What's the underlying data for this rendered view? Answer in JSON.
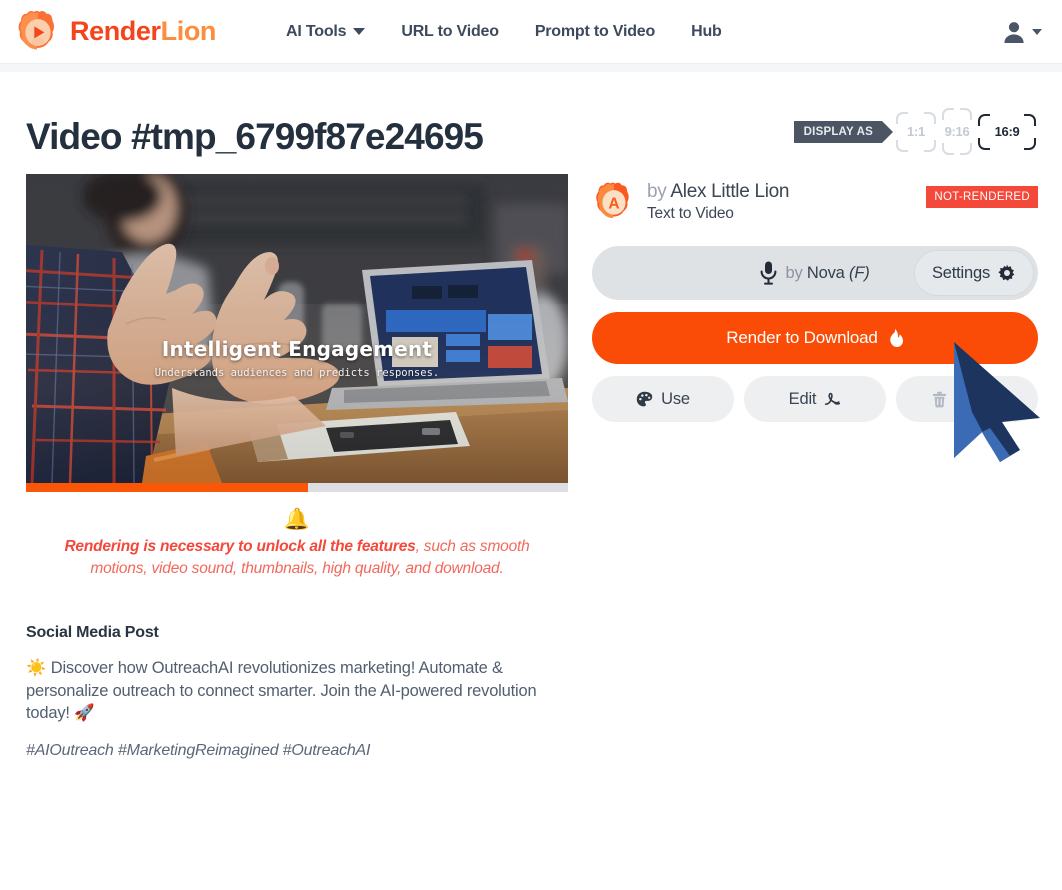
{
  "header": {
    "brand": {
      "part1": "Render",
      "part2": "Lion",
      "logo_icon": "lion-play-logo"
    },
    "nav": [
      {
        "label": "AI Tools",
        "has_caret": true
      },
      {
        "label": "URL to Video",
        "has_caret": false
      },
      {
        "label": "Prompt to Video",
        "has_caret": false
      },
      {
        "label": "Hub",
        "has_caret": false
      }
    ],
    "account": {
      "icon": "user-avatar-icon",
      "caret": "chevron-down-icon"
    }
  },
  "page": {
    "title": "Video #tmp_6799f87e24695"
  },
  "display_as": {
    "label": "DISPLAY AS",
    "options": [
      {
        "label": "1:1",
        "active": false
      },
      {
        "label": "9:16",
        "active": false
      },
      {
        "label": "16:9",
        "active": true
      }
    ]
  },
  "video": {
    "overlay_title": "Intelligent Engagement",
    "overlay_subtitle": "Understands audiences and predicts responses.",
    "progress_percent": 52
  },
  "warning": {
    "icon": "bell-icon",
    "bold_part": "Rendering is necessary to unlock all the features",
    "rest_part": ", such as smooth motions, video sound, thumbnails, high quality, and download."
  },
  "post": {
    "heading": "Social Media Post",
    "body": "☀️  Discover how OutreachAI revolutionizes marketing! Automate & personalize outreach to connect smarter. Join the AI-powered revolution today! 🚀",
    "tags": "#AIOutreach #MarketingReimagined #OutreachAI"
  },
  "author": {
    "avatar_icon": "lion-avatar-a",
    "by_word": "by",
    "name": "Alex Little Lion",
    "type": "Text to Video",
    "status": "NOT-RENDERED"
  },
  "voice": {
    "mic_icon": "microphone-icon",
    "by_word": "by",
    "name": "Nova",
    "gender": "(F)",
    "settings_label": "Settings",
    "settings_icon": "gear-icon"
  },
  "render": {
    "label": "Render to Download",
    "icon": "fire-icon"
  },
  "actions": [
    {
      "label": "Use",
      "icon": "palette-icon",
      "icon_side": "left",
      "muted": false
    },
    {
      "label": "Edit",
      "icon": "signature-icon",
      "icon_side": "right",
      "muted": false
    },
    {
      "label": "Delete",
      "icon": "trash-icon",
      "icon_side": "left",
      "muted": true
    }
  ],
  "colors": {
    "brand_orange_dark": "#f4441e",
    "brand_orange_light": "#fd8c3c",
    "render_orange": "#fa4c06",
    "status_red": "#f4483a",
    "nav_text": "#3d4a5c",
    "title_text": "#25303f"
  }
}
